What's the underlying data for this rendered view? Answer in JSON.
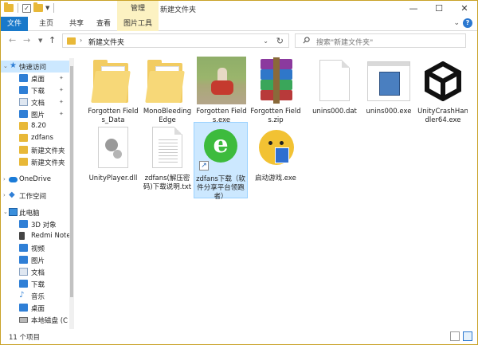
{
  "window": {
    "title": "新建文件夹",
    "context_group": "管理",
    "min_btn": "—",
    "max_btn": "☐",
    "close_btn": "✕"
  },
  "ribbon": {
    "tabs": [
      "文件",
      "主页",
      "共享",
      "查看",
      "图片工具"
    ],
    "help": "?"
  },
  "address_bar": {
    "path": "新建文件夹",
    "search_placeholder": "搜索\"新建文件夹\""
  },
  "sidebar": {
    "quick_access": "快速访问",
    "items": [
      {
        "label": "桌面",
        "pinned": true
      },
      {
        "label": "下载",
        "pinned": true
      },
      {
        "label": "文档",
        "pinned": true
      },
      {
        "label": "图片",
        "pinned": true
      },
      {
        "label": "8.20"
      },
      {
        "label": "zdfans"
      },
      {
        "label": "新建文件夹"
      },
      {
        "label": "新建文件夹"
      }
    ],
    "onedrive": "OneDrive",
    "workspace": "工作空间",
    "this_pc": "此电脑",
    "pc_items": [
      {
        "label": "3D 对象"
      },
      {
        "label": "Redmi Note"
      },
      {
        "label": "视频"
      },
      {
        "label": "图片"
      },
      {
        "label": "文档"
      },
      {
        "label": "下载"
      },
      {
        "label": "音乐"
      },
      {
        "label": "桌面"
      },
      {
        "label": "本地磁盘 (C"
      }
    ]
  },
  "files": [
    {
      "name": "Forgotten Fields_Data",
      "icon": "folder-icon"
    },
    {
      "name": "MonoBleeding Edge",
      "icon": "folder-icon"
    },
    {
      "name": "Forgotten Fields.exe",
      "icon": "game-photo-icon"
    },
    {
      "name": "Forgotten Fields.zip",
      "icon": "winrar-archive-icon"
    },
    {
      "name": "unins000.dat",
      "icon": "blank-document-icon"
    },
    {
      "name": "unins000.exe",
      "icon": "installer-exe-icon"
    },
    {
      "name": "UnityCrashHandler64.exe",
      "icon": "unity-logo-icon"
    },
    {
      "name": "UnityPlayer.dll",
      "icon": "dll-gears-icon"
    },
    {
      "name": "zdfans(解压密码)下载说明.txt",
      "icon": "text-document-icon"
    },
    {
      "name": "zdfans下载（软件分享平台领跑者）",
      "icon": "browser-shortcut-icon"
    },
    {
      "name": "启动游戏.exe",
      "icon": "chick-shield-icon"
    }
  ],
  "status": {
    "item_count": "11 个项目"
  }
}
